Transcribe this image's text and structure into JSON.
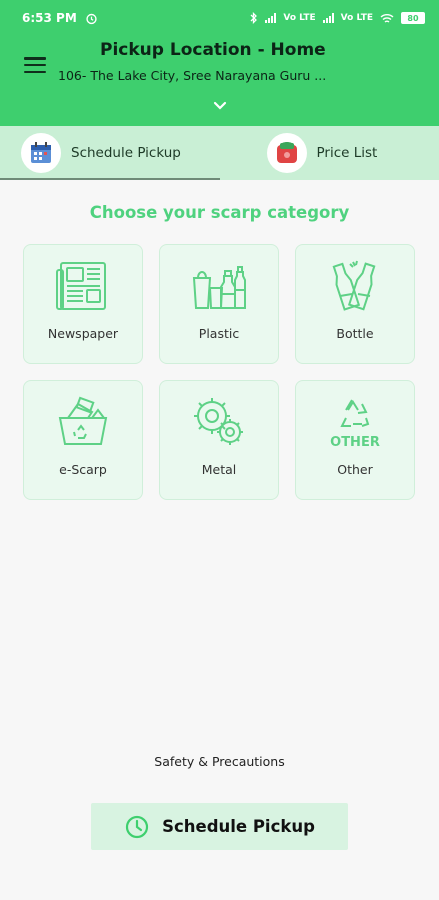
{
  "status_bar": {
    "time": "6:53 PM",
    "net1": "Vo LTE",
    "net2": "Vo LTE",
    "battery": "80"
  },
  "header": {
    "title": "Pickup Location - Home",
    "address": "106- The Lake City, Sree Narayana Guru ..."
  },
  "tabs": [
    {
      "label": "Schedule Pickup",
      "active": true
    },
    {
      "label": "Price List",
      "active": false
    }
  ],
  "main": {
    "section_title": "Choose your scarp category",
    "categories": [
      {
        "label": "Newspaper",
        "icon": "newspaper-icon"
      },
      {
        "label": "Plastic",
        "icon": "plastic-icon"
      },
      {
        "label": "Bottle",
        "icon": "bottle-icon"
      },
      {
        "label": "e-Scarp",
        "icon": "e-scrap-basket-icon"
      },
      {
        "label": "Metal",
        "icon": "gears-icon"
      },
      {
        "label": "Other",
        "icon": "recycle-other-icon",
        "icon_text": "OTHER"
      }
    ],
    "safety_link": "Safety & Precautions",
    "schedule_button": "Schedule Pickup"
  },
  "colors": {
    "primary_green": "#3ecf6e",
    "tab_bar": "#c9efd5",
    "card_bg": "#eaf9ef",
    "accent_text": "#4fd27f"
  }
}
